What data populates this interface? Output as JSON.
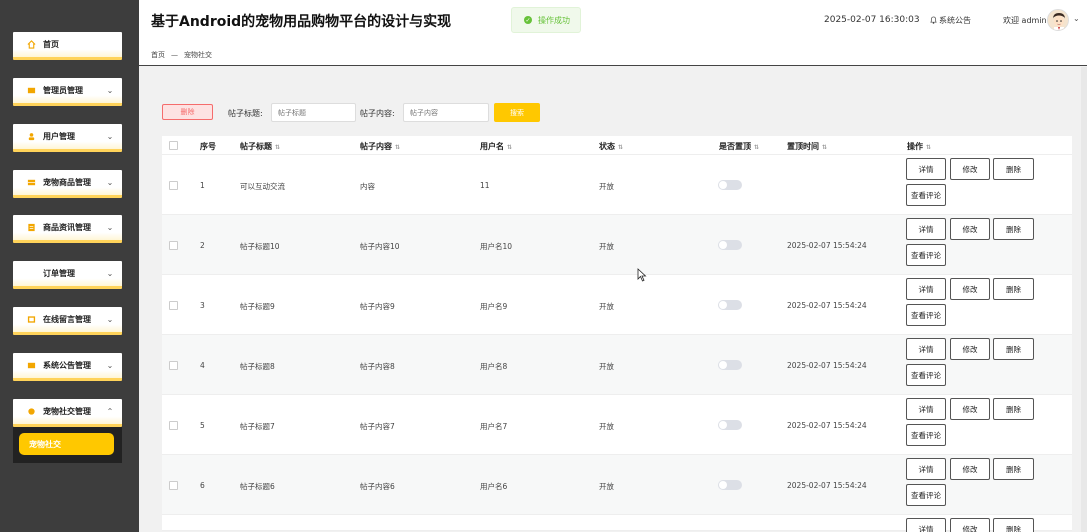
{
  "app": {
    "title": "基于Android的宠物用品购物平台的设计与实现",
    "toast": "操作成功",
    "datetime": "2025-02-07 16:30:03",
    "notice_label": "系统公告",
    "welcome": "欢迎 admin",
    "avatar_icon": "avatar-icon"
  },
  "sidebar": {
    "items": [
      {
        "label": "首页",
        "icon": "home-icon",
        "arrow": ""
      },
      {
        "label": "管理员管理",
        "icon": "folder-icon",
        "arrow": "⌄"
      },
      {
        "label": "用户管理",
        "icon": "user-icon",
        "arrow": "⌄"
      },
      {
        "label": "宠物商品管理",
        "icon": "list-icon",
        "arrow": "⌄"
      },
      {
        "label": "商品资讯管理",
        "icon": "news-icon",
        "arrow": "⌄"
      },
      {
        "label": "订单管理",
        "icon": "",
        "arrow": "⌄"
      },
      {
        "label": "在线留言管理",
        "icon": "message-icon",
        "arrow": "⌄"
      },
      {
        "label": "系统公告管理",
        "icon": "notice-icon",
        "arrow": "⌄"
      },
      {
        "label": "宠物社交管理",
        "icon": "social-icon",
        "arrow": "⌃"
      }
    ],
    "submenu": {
      "label": "宠物社交"
    }
  },
  "breadcrumb": {
    "home": "首页",
    "sep": "—",
    "current": "宠物社交"
  },
  "toolbar": {
    "batch_delete": "删除",
    "title_label": "帖子标题:",
    "title_placeholder": "帖子标题",
    "content_label": "帖子内容:",
    "content_placeholder": "帖子内容",
    "search": "搜索"
  },
  "table": {
    "headers": {
      "index": "序号",
      "title": "帖子标题",
      "content": "帖子内容",
      "username": "用户名",
      "status": "状态",
      "pinned": "是否置顶",
      "pinned_time": "置顶时间",
      "actions": "操作"
    },
    "action_labels": {
      "detail": "详情",
      "edit": "修改",
      "delete": "删除",
      "comments": "查看评论"
    },
    "rows": [
      {
        "index": "1",
        "title": "可以互动交流",
        "content": "内容",
        "username": "11",
        "status": "开放",
        "pinned": false,
        "pinned_time": ""
      },
      {
        "index": "2",
        "title": "帖子标题10",
        "content": "帖子内容10",
        "username": "用户名10",
        "status": "开放",
        "pinned": false,
        "pinned_time": "2025-02-07 15:54:24"
      },
      {
        "index": "3",
        "title": "帖子标题9",
        "content": "帖子内容9",
        "username": "用户名9",
        "status": "开放",
        "pinned": false,
        "pinned_time": "2025-02-07 15:54:24"
      },
      {
        "index": "4",
        "title": "帖子标题8",
        "content": "帖子内容8",
        "username": "用户名8",
        "status": "开放",
        "pinned": false,
        "pinned_time": "2025-02-07 15:54:24"
      },
      {
        "index": "5",
        "title": "帖子标题7",
        "content": "帖子内容7",
        "username": "用户名7",
        "status": "开放",
        "pinned": false,
        "pinned_time": "2025-02-07 15:54:24"
      },
      {
        "index": "6",
        "title": "帖子标题6",
        "content": "帖子内容6",
        "username": "用户名6",
        "status": "开放",
        "pinned": false,
        "pinned_time": "2025-02-07 15:54:24"
      }
    ]
  },
  "colors": {
    "accent": "#ffc800",
    "sidebar_bg": "#3d3d3d",
    "danger": "#f56c6c",
    "success": "#67c23a"
  }
}
